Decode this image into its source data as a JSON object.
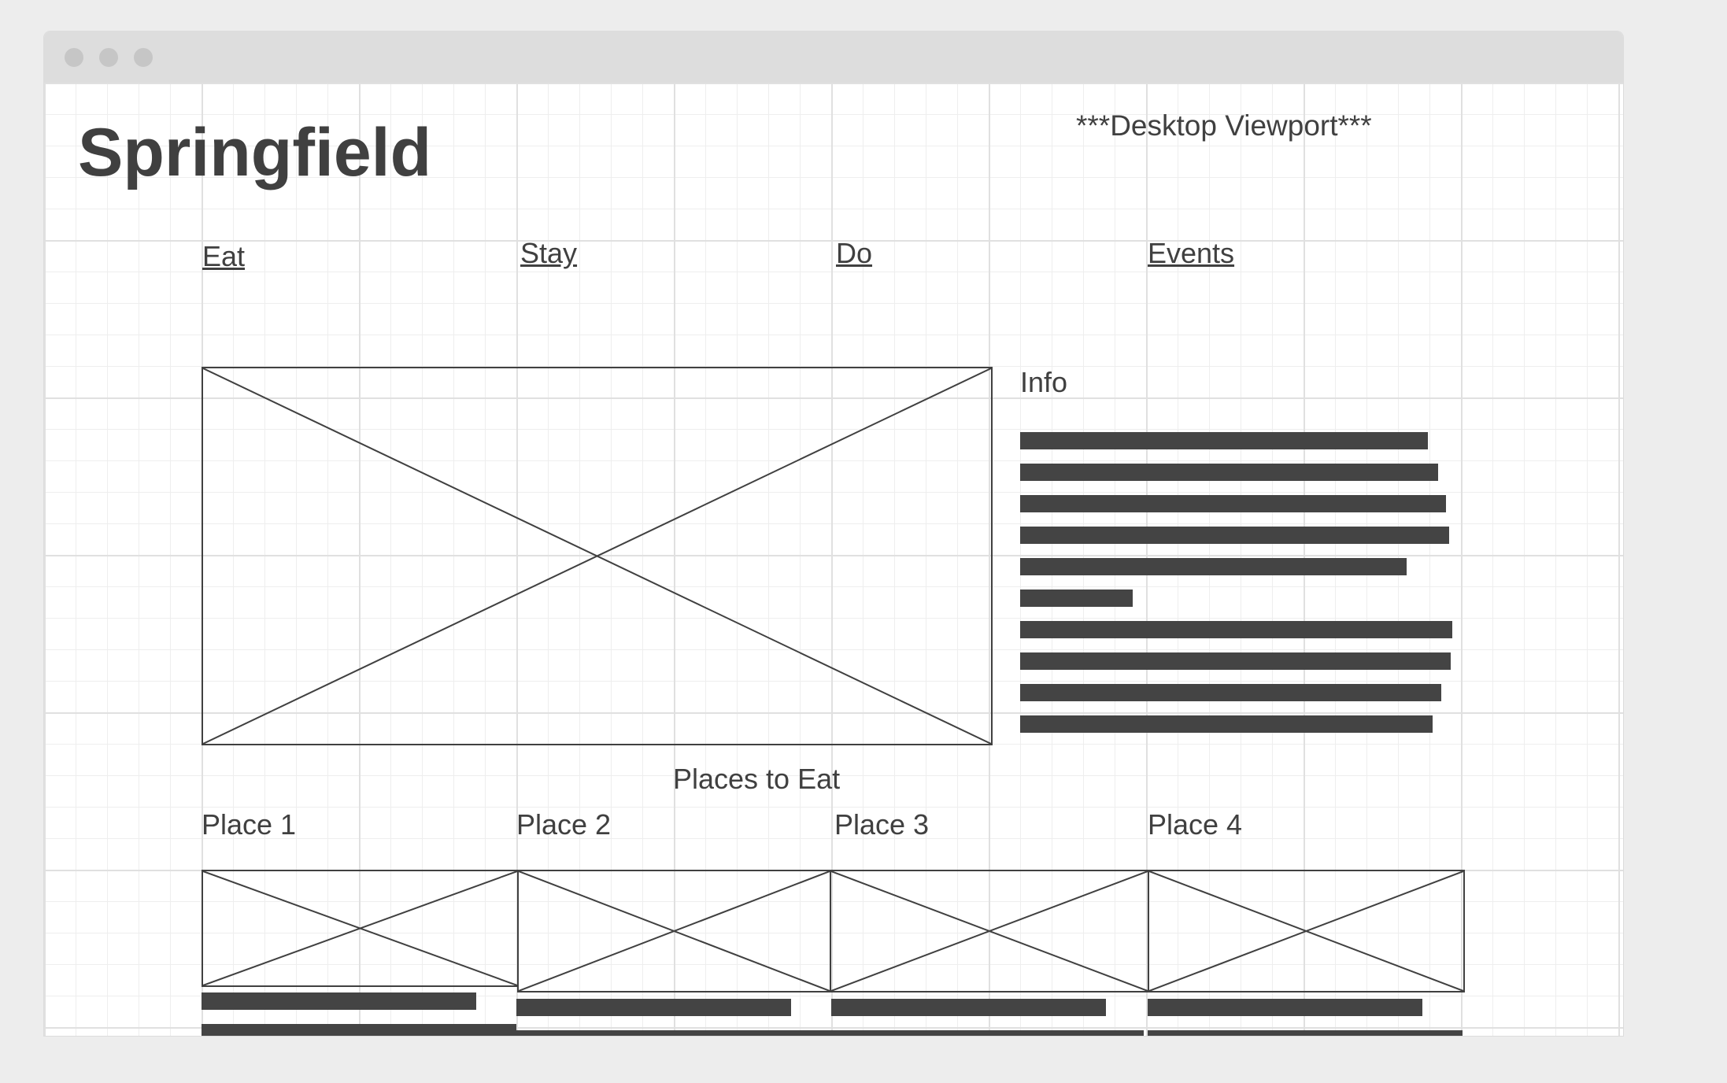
{
  "page": {
    "title": "Springfield",
    "viewport_note": "***Desktop Viewport***"
  },
  "nav": {
    "eat": "Eat",
    "stay": "Stay",
    "do": "Do",
    "events": "Events"
  },
  "info": {
    "heading": "Info"
  },
  "places": {
    "heading": "Places to Eat",
    "items": [
      {
        "label": "Place 1"
      },
      {
        "label": "Place 2"
      },
      {
        "label": "Place 3"
      },
      {
        "label": "Place 4"
      }
    ]
  },
  "colors": {
    "frame": "#dddddd",
    "ink": "#404040",
    "text_bar": "#444444",
    "grid": "#e0e0e0"
  }
}
